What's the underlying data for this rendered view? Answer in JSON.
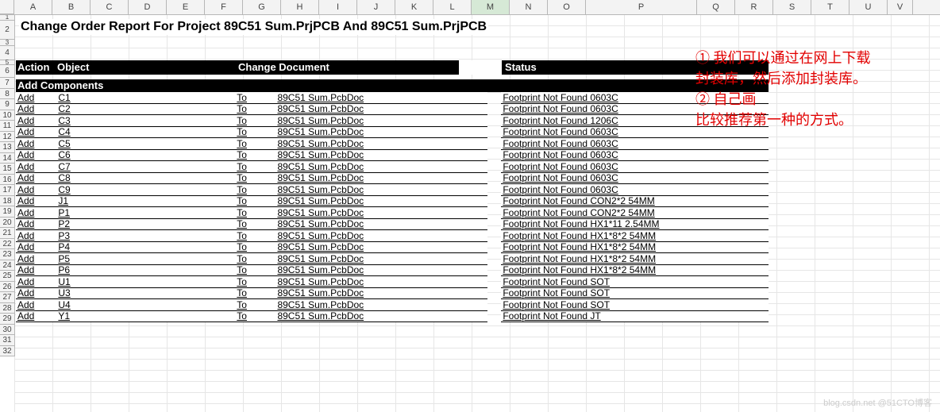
{
  "columns": [
    "A",
    "B",
    "C",
    "D",
    "E",
    "F",
    "G",
    "H",
    "I",
    "J",
    "K",
    "L",
    "M",
    "N",
    "O",
    "P",
    "Q",
    "R",
    "S",
    "T",
    "U",
    "V"
  ],
  "selected_column": "M",
  "row_count_visible": 32,
  "title": "Change Order Report For Project  89C51  Sum.PrjPCB And 89C51  Sum.PrjPCB",
  "headers": {
    "action": "Action",
    "object": "Object",
    "change_doc": "Change Document",
    "status": "Status"
  },
  "section": "Add Components",
  "rows": [
    {
      "action": "Add",
      "object": "C1",
      "to": "To",
      "doc": "89C51  Sum.PcbDoc",
      "status": "Footprint Not Found 0603C"
    },
    {
      "action": "Add",
      "object": "C2",
      "to": "To",
      "doc": "89C51  Sum.PcbDoc",
      "status": "Footprint Not Found 0603C"
    },
    {
      "action": "Add",
      "object": "C3",
      "to": "To",
      "doc": "89C51  Sum.PcbDoc",
      "status": "Footprint Not Found 1206C"
    },
    {
      "action": "Add",
      "object": "C4",
      "to": "To",
      "doc": "89C51  Sum.PcbDoc",
      "status": "Footprint Not Found 0603C"
    },
    {
      "action": "Add",
      "object": "C5",
      "to": "To",
      "doc": "89C51  Sum.PcbDoc",
      "status": "Footprint Not Found 0603C"
    },
    {
      "action": "Add",
      "object": "C6",
      "to": "To",
      "doc": "89C51  Sum.PcbDoc",
      "status": "Footprint Not Found 0603C"
    },
    {
      "action": "Add",
      "object": "C7",
      "to": "To",
      "doc": "89C51  Sum.PcbDoc",
      "status": "Footprint Not Found 0603C"
    },
    {
      "action": "Add",
      "object": "C8",
      "to": "To",
      "doc": "89C51  Sum.PcbDoc",
      "status": "Footprint Not Found 0603C"
    },
    {
      "action": "Add",
      "object": "C9",
      "to": "To",
      "doc": "89C51  Sum.PcbDoc",
      "status": "Footprint Not Found 0603C"
    },
    {
      "action": "Add",
      "object": "J1",
      "to": "To",
      "doc": "89C51  Sum.PcbDoc",
      "status": "Footprint Not Found CON2*2 54MM"
    },
    {
      "action": "Add",
      "object": "P1",
      "to": "To",
      "doc": "89C51  Sum.PcbDoc",
      "status": "Footprint Not Found CON2*2 54MM"
    },
    {
      "action": "Add",
      "object": "P2",
      "to": "To",
      "doc": "89C51  Sum.PcbDoc",
      "status": "Footprint Not Found HX1*11 2.54MM"
    },
    {
      "action": "Add",
      "object": "P3",
      "to": "To",
      "doc": "89C51  Sum.PcbDoc",
      "status": "Footprint Not Found HX1*8*2 54MM"
    },
    {
      "action": "Add",
      "object": "P4",
      "to": "To",
      "doc": "89C51  Sum.PcbDoc",
      "status": "Footprint Not Found HX1*8*2 54MM"
    },
    {
      "action": "Add",
      "object": "P5",
      "to": "To",
      "doc": "89C51  Sum.PcbDoc",
      "status": "Footprint Not Found HX1*8*2 54MM"
    },
    {
      "action": "Add",
      "object": "P6",
      "to": "To",
      "doc": "89C51  Sum.PcbDoc",
      "status": "Footprint Not Found HX1*8*2 54MM"
    },
    {
      "action": "Add",
      "object": "U1",
      "to": "To",
      "doc": "89C51  Sum.PcbDoc",
      "status": "Footprint Not Found SOT"
    },
    {
      "action": "Add",
      "object": "U3",
      "to": "To",
      "doc": "89C51  Sum.PcbDoc",
      "status": "Footprint Not Found SOT"
    },
    {
      "action": "Add",
      "object": "U4",
      "to": "To",
      "doc": "89C51  Sum.PcbDoc",
      "status": "Footprint Not Found SOT"
    },
    {
      "action": "Add",
      "object": "Y1",
      "to": "To",
      "doc": "89C51  Sum.PcbDoc",
      "status": "Footprint Not Found JT"
    }
  ],
  "annotation": {
    "line1": "① 我们可以通过在网上下载",
    "line2": "封装库，然后添加封装库。",
    "line3": "② 自己画",
    "line4": "比较推荐第一种的方式。"
  },
  "watermark": "blog.csdn.net @51CTO博客"
}
